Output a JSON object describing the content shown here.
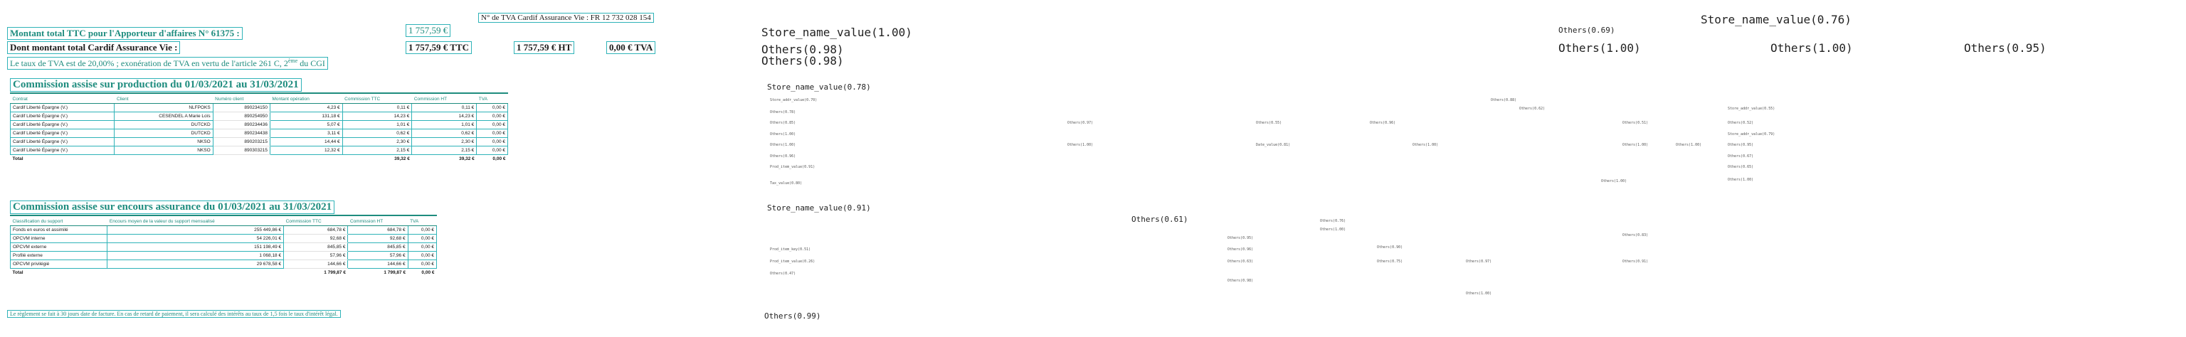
{
  "header": {
    "tva_number_label": "N° de TVA Cardif Assurance Vie : FR 12 732 028 154",
    "montant_total_label": "Montant total TTC pour l'Apporteur d'affaires N° 61375 :",
    "montant_total_value": "1 757,59 €",
    "dont_label": "Dont montant total Cardif Assurance Vie :",
    "dont_ttc": "1 757,59 € TTC",
    "dont_ht": "1 757,59 € HT",
    "dont_tva": "0,00 € TVA",
    "tva_note": "Le taux de TVA est de 20,00% ; exonération de TVA en vertu de l'article 261 C, 2",
    "tva_note_sup": "ème",
    "tva_note_end": " du CGI"
  },
  "production": {
    "title": "Commission assise sur production du 01/03/2021 au 31/03/2021",
    "columns": [
      "Contrat",
      "Client",
      "Numéro client",
      "Montant opération",
      "Commission TTC",
      "Commission HT",
      "TVA"
    ],
    "rows": [
      [
        "Cardif Liberté Épargne (V.)",
        "NLFPOKS",
        "890234150",
        "4,23 €",
        "0,11 €",
        "0,11 €",
        "0,00 €"
      ],
      [
        "Cardif Liberté Épargne (V.)",
        "CESENDEL A Marie Loïs",
        "890254950",
        "131,18 €",
        "14,23 €",
        "14,23 €",
        "0,00 €"
      ],
      [
        "Cardif Liberté Épargne (V.)",
        "DUTCKD",
        "890234436",
        "5,07 €",
        "1,01 €",
        "1,01 €",
        "0,00 €"
      ],
      [
        "Cardif Liberté Épargne (V.)",
        "DUTCKD",
        "890234438",
        "3,11 €",
        "0,62 €",
        "0,62 €",
        "0,00 €"
      ],
      [
        "Cardif Liberté Épargne (V.)",
        "NKSO",
        "890203215",
        "14,44 €",
        "2,30 €",
        "2,30 €",
        "0,00 €"
      ],
      [
        "Cardif Liberté Épargne (V.)",
        "NKSO",
        "890303215",
        "12,32 €",
        "2,15 €",
        "2,15 €",
        "0,00 €"
      ]
    ],
    "total": [
      "Total",
      "",
      "",
      "",
      "39,32 €",
      "39,32 €",
      "0,00 €"
    ]
  },
  "encours": {
    "title": "Commission assise sur encours assurance du 01/03/2021 au 31/03/2021",
    "columns": [
      "Classification du support",
      "Encours moyen de la valeur du support mensualisé",
      "Commission TTC",
      "Commission HT",
      "TVA"
    ],
    "rows": [
      [
        "Fonds en euros et assimilé",
        "255 449,86 €",
        "684,78 €",
        "684,78 €",
        "0,00 €"
      ],
      [
        "OPCVM interne",
        "54 226,01 €",
        "92,68 €",
        "92,68 €",
        "0,00 €"
      ],
      [
        "OPCVM externe",
        "151 198,49 €",
        "845,85 €",
        "845,85 €",
        "0,00 €"
      ],
      [
        "Profilé externe",
        "1 068,18 €",
        "57,96 €",
        "57,96 €",
        "0,00 €"
      ],
      [
        "OPCVM privilégié",
        "29 678,58 €",
        "144,66 €",
        "144,66 €",
        "0,00 €"
      ]
    ],
    "total": [
      "Total",
      "",
      "1 799,87 €",
      "1 799,87 €",
      "0,00 €"
    ]
  },
  "footer_note": "Le règlement se fait à 30 jours date de facture. En cas de retard de paiement, il sera calculé des intérêts au taux de 1,5 fois le taux d'intérêt légal.",
  "ocr_labels": [
    {
      "text": "Store_name_value(1.00)",
      "size": "big"
    },
    {
      "text": "Others(0.98)",
      "size": "big"
    },
    {
      "text": "Others(0.98)",
      "size": "big"
    },
    {
      "text": "Store_name_value(0.76)",
      "size": "big"
    },
    {
      "text": "Others(0.69)",
      "size": "mid"
    },
    {
      "text": "Others(1.00)",
      "size": "big"
    },
    {
      "text": "Others(1.00)",
      "size": "big"
    },
    {
      "text": "Others(0.95)",
      "size": "big"
    },
    {
      "text": "Store_name_value(0.78)",
      "size": "mid"
    },
    {
      "text": "Store_addr_value(0.70)",
      "size": "small"
    },
    {
      "text": "Others(0.78)",
      "size": "small"
    },
    {
      "text": "Others(0.85)",
      "size": "small"
    },
    {
      "text": "Others(1.00)",
      "size": "small"
    },
    {
      "text": "Others(1.00)",
      "size": "small"
    },
    {
      "text": "Others(0.96)",
      "size": "small"
    },
    {
      "text": "Prod_item_value(0.91)",
      "size": "small"
    },
    {
      "text": "Tax_value(0.80)",
      "size": "small"
    },
    {
      "text": "Others(0.97)",
      "size": "small"
    },
    {
      "text": "Others(1.00)",
      "size": "small"
    },
    {
      "text": "Others(0.55)",
      "size": "small"
    },
    {
      "text": "Date_value(0.81)",
      "size": "small"
    },
    {
      "text": "Others(0.96)",
      "size": "small"
    },
    {
      "text": "Others(1.00)",
      "size": "small"
    },
    {
      "text": "Others(0.88)",
      "size": "small"
    },
    {
      "text": "Others(0.62)",
      "size": "small"
    },
    {
      "text": "Others(0.51)",
      "size": "small"
    },
    {
      "text": "Others(1.00)",
      "size": "small"
    },
    {
      "text": "Others(1.00)",
      "size": "small"
    },
    {
      "text": "Others(1.00)",
      "size": "small"
    },
    {
      "text": "Store_addr_value(0.55)",
      "size": "small"
    },
    {
      "text": "Others(0.52)",
      "size": "small"
    },
    {
      "text": "Store_addr_value(0.79)",
      "size": "small"
    },
    {
      "text": "Others(0.95)",
      "size": "small"
    },
    {
      "text": "Others(0.67)",
      "size": "small"
    },
    {
      "text": "Others(0.65)",
      "size": "small"
    },
    {
      "text": "Others(1.00)",
      "size": "small"
    },
    {
      "text": "Store_name_value(0.91)",
      "size": "mid"
    },
    {
      "text": "Others(0.61)",
      "size": "mid"
    },
    {
      "text": "Others(0.95)",
      "size": "small"
    },
    {
      "text": "Others(0.76)",
      "size": "small"
    },
    {
      "text": "Others(1.00)",
      "size": "small"
    },
    {
      "text": "Others(0.83)",
      "size": "small"
    },
    {
      "text": "Others(0.96)",
      "size": "small"
    },
    {
      "text": "Prod_item_key(0.51)",
      "size": "small"
    },
    {
      "text": "Prod_item_value(0.26)",
      "size": "small"
    },
    {
      "text": "Others(0.47)",
      "size": "small"
    },
    {
      "text": "Others(0.98)",
      "size": "small"
    },
    {
      "text": "Others(0.63)",
      "size": "small"
    },
    {
      "text": "Others(0.75)",
      "size": "small"
    },
    {
      "text": "Others(0.97)",
      "size": "small"
    },
    {
      "text": "Others(0.91)",
      "size": "small"
    },
    {
      "text": "Others(0.90)",
      "size": "small"
    },
    {
      "text": "Others(1.00)",
      "size": "small"
    },
    {
      "text": "Others(0.99)",
      "size": "mid"
    }
  ]
}
